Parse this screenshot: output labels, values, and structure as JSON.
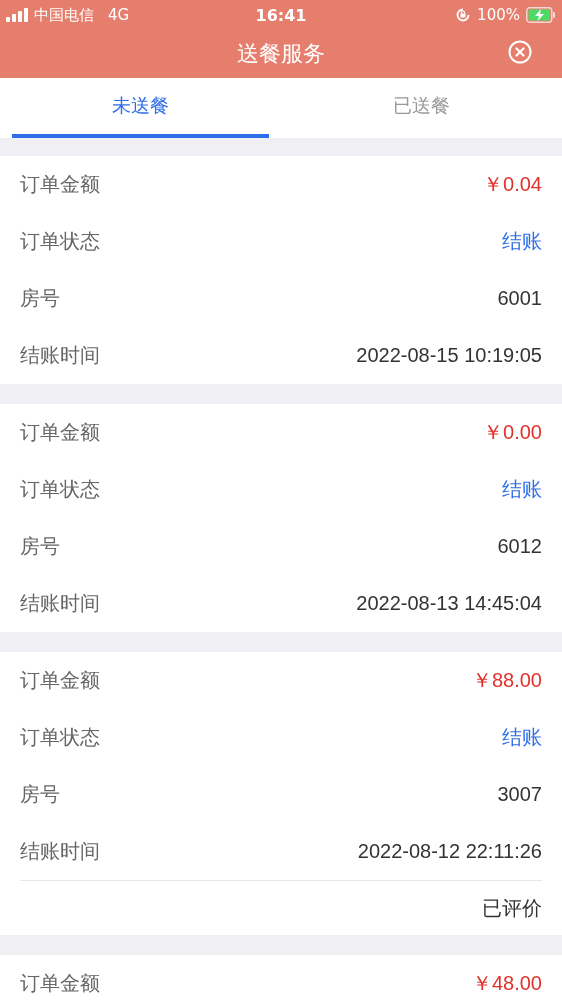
{
  "status_bar": {
    "carrier": "中国电信",
    "network": "4G",
    "time": "16:41",
    "battery": "100%"
  },
  "header": {
    "title": "送餐服务"
  },
  "tabs": [
    {
      "label": "未送餐",
      "selected": true
    },
    {
      "label": "已送餐",
      "selected": false
    }
  ],
  "orders": [
    {
      "rows": [
        {
          "kind": "amount",
          "label": "订单金额",
          "value": "￥0.04"
        },
        {
          "kind": "status",
          "label": "订单状态",
          "value": "结账"
        },
        {
          "kind": "plain",
          "label": "房号",
          "value": "6001"
        },
        {
          "kind": "plain",
          "label": "结账时间",
          "value": "2022-08-15 10:19:05"
        }
      ]
    },
    {
      "rows": [
        {
          "kind": "amount",
          "label": "订单金额",
          "value": "￥0.00"
        },
        {
          "kind": "status",
          "label": "订单状态",
          "value": "结账"
        },
        {
          "kind": "plain",
          "label": "房号",
          "value": "6012"
        },
        {
          "kind": "plain",
          "label": "结账时间",
          "value": "2022-08-13 14:45:04"
        }
      ]
    },
    {
      "rows": [
        {
          "kind": "amount",
          "label": "订单金额",
          "value": "￥88.00"
        },
        {
          "kind": "status",
          "label": "订单状态",
          "value": "结账"
        },
        {
          "kind": "plain",
          "label": "房号",
          "value": "3007"
        },
        {
          "kind": "plain",
          "label": "结账时间",
          "value": "2022-08-12 22:11:26"
        }
      ],
      "footer": "已评价"
    },
    {
      "rows": [
        {
          "kind": "amount",
          "label": "订单金额",
          "value": "￥48.00"
        }
      ]
    }
  ]
}
